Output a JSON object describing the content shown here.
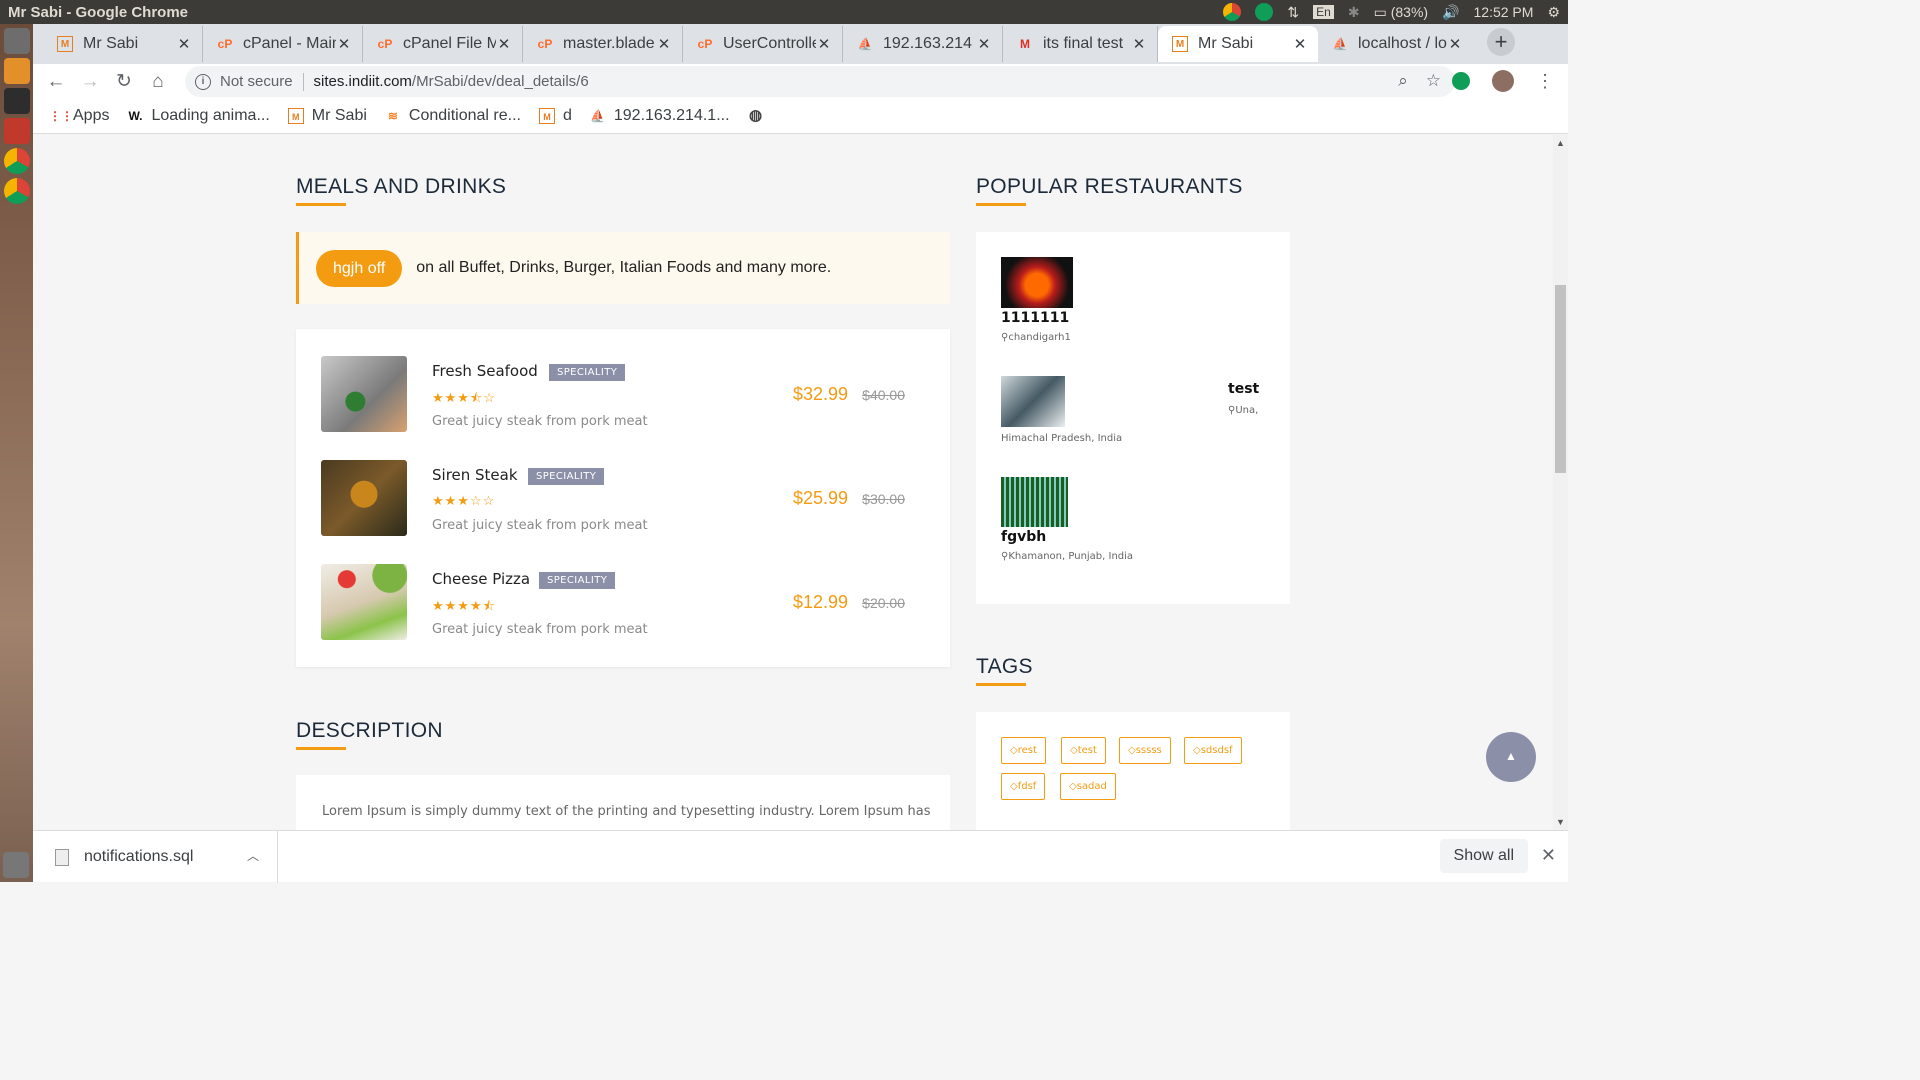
{
  "system": {
    "window_title": "Mr Sabi - Google Chrome",
    "lang": "En",
    "battery": "(83%)",
    "time": "12:52 PM"
  },
  "tabs": [
    {
      "label": "Mr Sabi",
      "icon": "mail-favicon"
    },
    {
      "label": "cPanel - Main",
      "icon": "cpanel-favicon"
    },
    {
      "label": "cPanel File Manager",
      "icon": "cpanel-favicon"
    },
    {
      "label": "master.blade",
      "icon": "cpanel-favicon"
    },
    {
      "label": "UserController",
      "icon": "cpanel-favicon"
    },
    {
      "label": "192.163.214",
      "icon": "phpmyadmin-favicon"
    },
    {
      "label": "its final test",
      "icon": "gmail-favicon"
    },
    {
      "label": "Mr Sabi",
      "icon": "mail-favicon",
      "active": true
    },
    {
      "label": "localhost / localhost",
      "icon": "phpmyadmin-favicon"
    }
  ],
  "address": {
    "security": "Not secure",
    "host": "sites.indiit.com",
    "path": "/MrSabi/dev/deal_details/6"
  },
  "bookmarks": [
    {
      "label": "Apps",
      "icon": "apps-grid-icon"
    },
    {
      "label": "Loading anima...",
      "icon": "w-icon"
    },
    {
      "label": "Mr Sabi",
      "icon": "mail-favicon"
    },
    {
      "label": "Conditional re...",
      "icon": "stack-icon"
    },
    {
      "label": "d",
      "icon": "mail-favicon"
    },
    {
      "label": "192.163.214.1...",
      "icon": "phpmyadmin-favicon"
    },
    {
      "label": "",
      "icon": "globe-icon"
    }
  ],
  "meals": {
    "title": "MEALS AND DRINKS",
    "offer_pill": "hgjh off",
    "offer_text": "on all Buffet, Drinks, Burger, Italian Foods and many more.",
    "items": [
      {
        "name": "Fresh Seafood",
        "badge": "SPECIALITY",
        "rating": 3.5,
        "stars": "★★★⯪☆",
        "desc": "Great juicy steak from pork meat",
        "price": "$32.99",
        "old_price": "$40.00"
      },
      {
        "name": "Siren Steak",
        "badge": "SPECIALITY",
        "rating": 3,
        "stars": "★★★☆☆",
        "desc": "Great juicy steak from pork meat",
        "price": "$25.99",
        "old_price": "$30.00"
      },
      {
        "name": "Cheese Pizza",
        "badge": "SPECIALITY",
        "rating": 4.5,
        "stars": "★★★★⯪",
        "desc": "Great juicy steak from pork meat",
        "price": "$12.99",
        "old_price": "$20.00"
      }
    ]
  },
  "description": {
    "title": "DESCRIPTION",
    "text": "Lorem Ipsum is simply dummy text of the printing and typesetting industry. Lorem Ipsum has"
  },
  "popular": {
    "title": "POPULAR RESTAURANTS",
    "items": [
      {
        "name": "1111111",
        "location": "chandigarh1"
      },
      {
        "name": "test",
        "location": "Una,",
        "location2": "Himachal Pradesh, India"
      },
      {
        "name": "fgvbh",
        "location": "Khamanon, Punjab, India"
      }
    ]
  },
  "tags": {
    "title": "TAGS",
    "items": [
      "rest",
      "test",
      "sssss",
      "sdsdsf",
      "fdsf",
      "sadad"
    ]
  },
  "downloads": {
    "file": "notifications.sql",
    "show_all": "Show all"
  },
  "colors": {
    "accent": "#f39c12",
    "badge": "#8c8fa8"
  }
}
